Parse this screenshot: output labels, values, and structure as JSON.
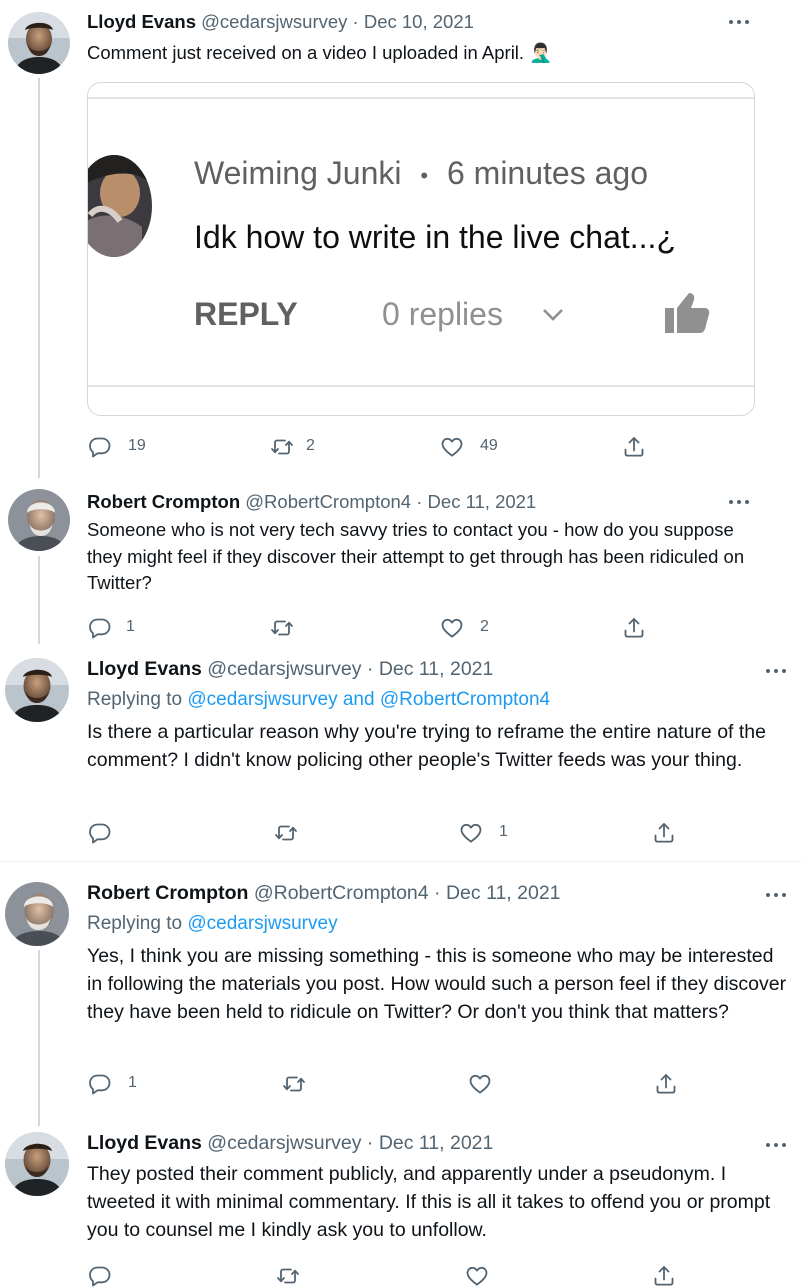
{
  "tweets": [
    {
      "name": "Lloyd Evans",
      "handle": "@cedarsjwsurvey",
      "date": "Dec 10, 2021",
      "text": "Comment just received on a video I uploaded in April. 🤦🏻‍♂️",
      "actions": {
        "replies": "19",
        "retweets": "2",
        "likes": "49"
      }
    },
    {
      "name": "Robert Crompton",
      "handle": "@RobertCrompton4",
      "date": "Dec 11, 2021",
      "text": "Someone who is not very tech savvy tries to contact you - how do you suppose they might feel if they discover their attempt to get through has been ridiculed on Twitter?",
      "actions": {
        "replies": "1",
        "retweets": "",
        "likes": "2"
      }
    },
    {
      "name": "Lloyd Evans",
      "handle": "@cedarsjwsurvey",
      "date": "Dec 11, 2021",
      "replying_prefix": "Replying to",
      "replying_users": "@cedarsjwsurvey and @RobertCrompton4",
      "text": "Is there a particular reason why you're trying to reframe the entire nature of the comment? I didn't know policing other people's Twitter feeds was your thing.",
      "actions": {
        "replies": "",
        "retweets": "",
        "likes": "1"
      }
    },
    {
      "name": "Robert Crompton",
      "handle": "@RobertCrompton4",
      "date": "Dec 11, 2021",
      "replying_prefix": "Replying to",
      "replying_users": "@cedarsjwsurvey",
      "text": "Yes, I think you are missing something - this is someone who may be interested in following the materials you post. How would such a person feel if they discover they have been held to ridicule on Twitter? Or don't you think that matters?",
      "actions": {
        "replies": "1",
        "retweets": "",
        "likes": ""
      }
    },
    {
      "name": "Lloyd Evans",
      "handle": "@cedarsjwsurvey",
      "date": "Dec 11, 2021",
      "text": "They posted their comment publicly, and apparently under a pseudonym. I tweeted it with minimal commentary. If this is all it takes to offend you or prompt you to counsel me I kindly ask you to unfollow.",
      "actions": {
        "replies": "",
        "retweets": "",
        "likes": ""
      }
    }
  ],
  "embedded_comment": {
    "author": "Weiming Junki",
    "separator": "•",
    "time": "6 minutes ago",
    "text": "Idk how to write in the live chat...¿",
    "reply_label": "REPLY",
    "replies_label": "0 replies"
  },
  "icons": {
    "reply": "reply-icon",
    "retweet": "retweet-icon",
    "like": "heart-icon",
    "share": "share-icon",
    "more": "more-icon",
    "thumbs_up": "thumbs-up-icon",
    "chevron": "chevron-down-icon"
  },
  "colors": {
    "text": "#0f1419",
    "secondary": "#536471",
    "link": "#1d9bf0",
    "thread_line": "#cfd9de"
  }
}
